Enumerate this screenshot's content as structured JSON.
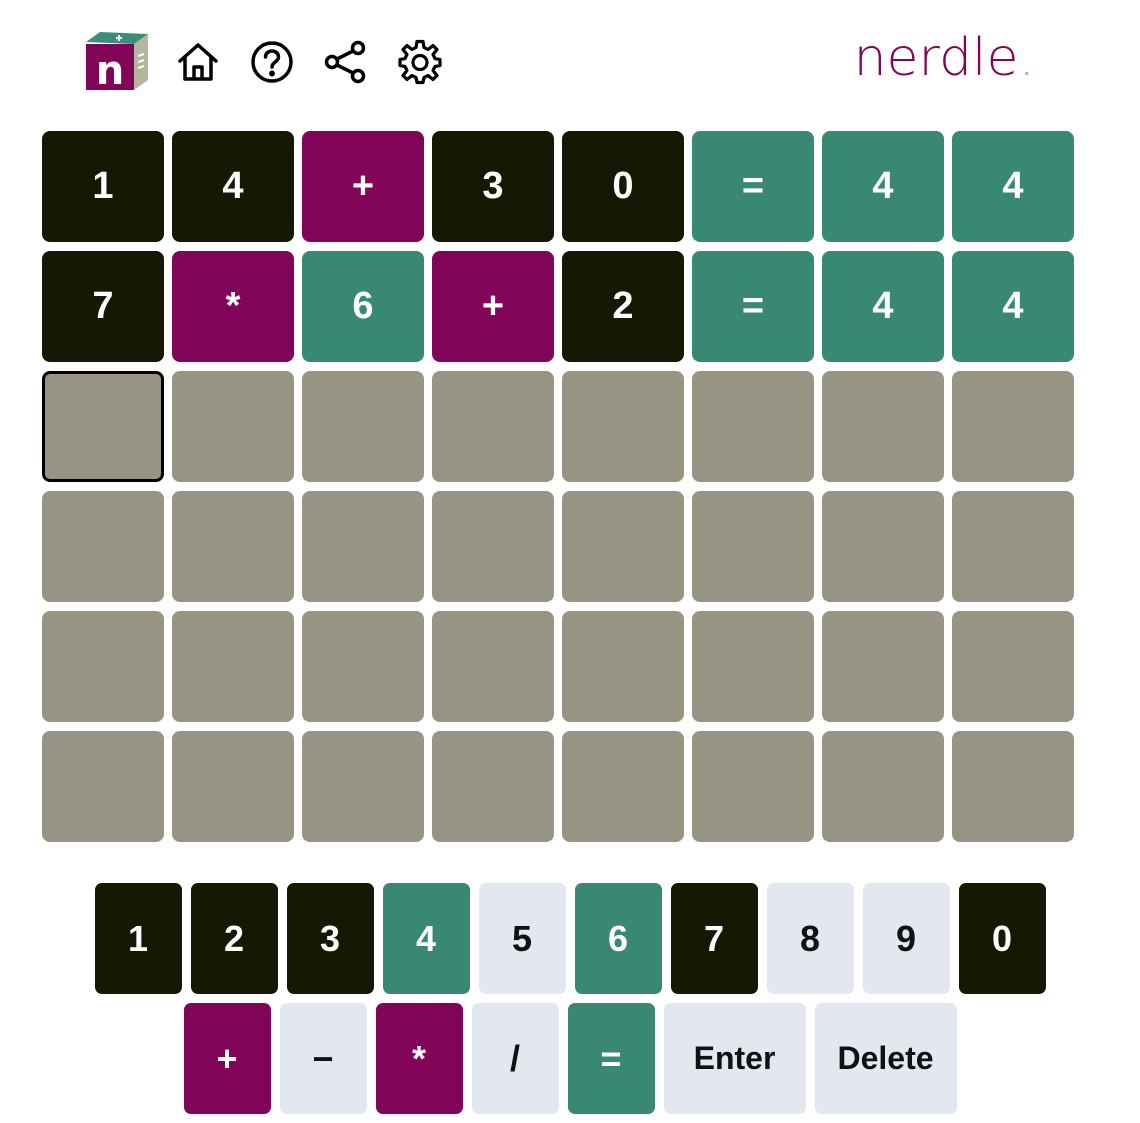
{
  "header": {
    "brand_name": "nerdle",
    "brand_dot": ".",
    "logo_letter": "n",
    "icons": [
      "home-icon",
      "help-icon",
      "share-icon",
      "settings-icon"
    ]
  },
  "colors": {
    "absent": "#161803",
    "present": "#820458",
    "correct": "#398874",
    "empty": "#989484",
    "unused_key": "#e2e7f0"
  },
  "board": {
    "rows": [
      [
        {
          "v": "1",
          "s": "absent"
        },
        {
          "v": "4",
          "s": "absent"
        },
        {
          "v": "+",
          "s": "present"
        },
        {
          "v": "3",
          "s": "absent"
        },
        {
          "v": "0",
          "s": "absent"
        },
        {
          "v": "=",
          "s": "correct"
        },
        {
          "v": "4",
          "s": "correct"
        },
        {
          "v": "4",
          "s": "correct"
        }
      ],
      [
        {
          "v": "7",
          "s": "absent"
        },
        {
          "v": "*",
          "s": "present"
        },
        {
          "v": "6",
          "s": "correct"
        },
        {
          "v": "+",
          "s": "present"
        },
        {
          "v": "2",
          "s": "absent"
        },
        {
          "v": "=",
          "s": "correct"
        },
        {
          "v": "4",
          "s": "correct"
        },
        {
          "v": "4",
          "s": "correct"
        }
      ],
      [
        {
          "v": "",
          "s": "active"
        },
        {
          "v": "",
          "s": "empty"
        },
        {
          "v": "",
          "s": "empty"
        },
        {
          "v": "",
          "s": "empty"
        },
        {
          "v": "",
          "s": "empty"
        },
        {
          "v": "",
          "s": "empty"
        },
        {
          "v": "",
          "s": "empty"
        },
        {
          "v": "",
          "s": "empty"
        }
      ],
      [
        {
          "v": "",
          "s": "empty"
        },
        {
          "v": "",
          "s": "empty"
        },
        {
          "v": "",
          "s": "empty"
        },
        {
          "v": "",
          "s": "empty"
        },
        {
          "v": "",
          "s": "empty"
        },
        {
          "v": "",
          "s": "empty"
        },
        {
          "v": "",
          "s": "empty"
        },
        {
          "v": "",
          "s": "empty"
        }
      ],
      [
        {
          "v": "",
          "s": "empty"
        },
        {
          "v": "",
          "s": "empty"
        },
        {
          "v": "",
          "s": "empty"
        },
        {
          "v": "",
          "s": "empty"
        },
        {
          "v": "",
          "s": "empty"
        },
        {
          "v": "",
          "s": "empty"
        },
        {
          "v": "",
          "s": "empty"
        },
        {
          "v": "",
          "s": "empty"
        }
      ],
      [
        {
          "v": "",
          "s": "empty"
        },
        {
          "v": "",
          "s": "empty"
        },
        {
          "v": "",
          "s": "empty"
        },
        {
          "v": "",
          "s": "empty"
        },
        {
          "v": "",
          "s": "empty"
        },
        {
          "v": "",
          "s": "empty"
        },
        {
          "v": "",
          "s": "empty"
        },
        {
          "v": "",
          "s": "empty"
        }
      ]
    ]
  },
  "keyboard": {
    "row1": [
      {
        "label": "1",
        "s": "absent"
      },
      {
        "label": "2",
        "s": "absent"
      },
      {
        "label": "3",
        "s": "absent"
      },
      {
        "label": "4",
        "s": "correct"
      },
      {
        "label": "5",
        "s": "unused"
      },
      {
        "label": "6",
        "s": "correct"
      },
      {
        "label": "7",
        "s": "absent"
      },
      {
        "label": "8",
        "s": "unused"
      },
      {
        "label": "9",
        "s": "unused"
      },
      {
        "label": "0",
        "s": "absent"
      }
    ],
    "row2": [
      {
        "label": "+",
        "s": "present"
      },
      {
        "label": "−",
        "s": "unused"
      },
      {
        "label": "*",
        "s": "present"
      },
      {
        "label": "/",
        "s": "unused"
      },
      {
        "label": "=",
        "s": "correct"
      },
      {
        "label": "Enter",
        "s": "unused",
        "wide": true
      },
      {
        "label": "Delete",
        "s": "unused",
        "wide": true
      }
    ]
  }
}
